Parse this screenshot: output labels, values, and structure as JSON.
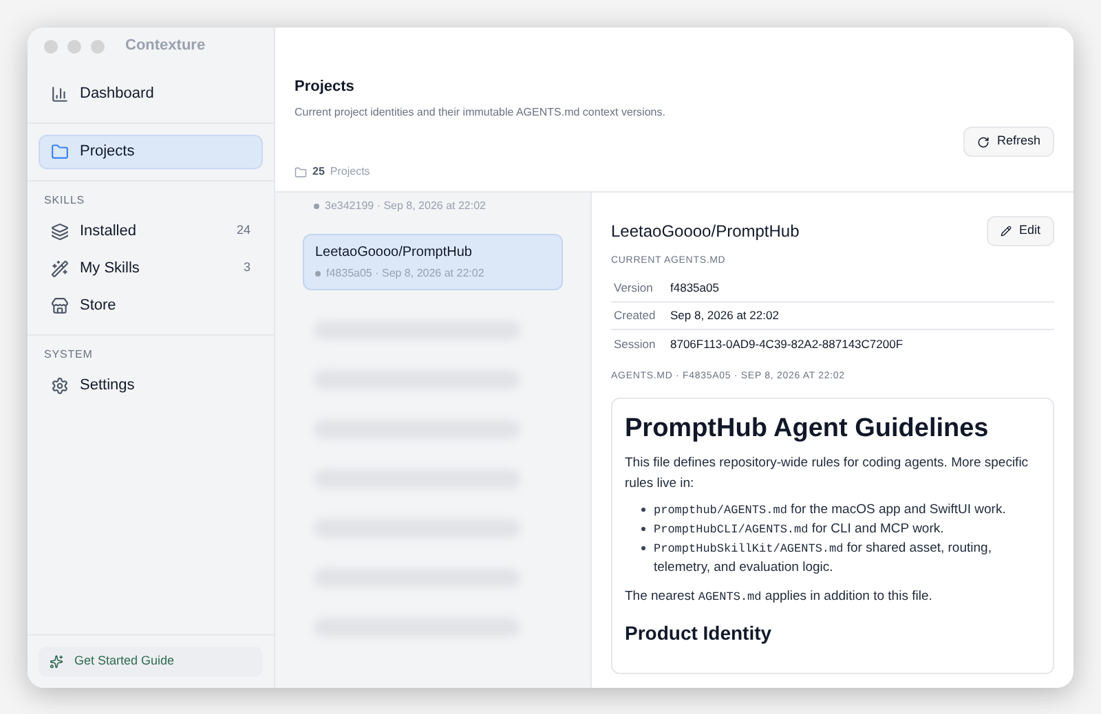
{
  "window": {
    "title": "Contexture"
  },
  "sidebar": {
    "items": [
      {
        "kind": "dashboard",
        "label": "Dashboard",
        "selected": false
      }
    ],
    "sections": [
      {
        "items": [
          {
            "kind": "projects",
            "label": "Projects",
            "selected": true
          }
        ]
      },
      {
        "title": "SKILLS",
        "items": [
          {
            "kind": "installed",
            "label": "Installed",
            "count": "24",
            "selected": false
          },
          {
            "kind": "skills",
            "label": "My Skills",
            "count": "3",
            "selected": false
          },
          {
            "kind": "store",
            "label": "Store",
            "selected": false
          }
        ]
      },
      {
        "title": "SYSTEM",
        "items": [
          {
            "kind": "settings",
            "label": "Settings",
            "selected": false
          }
        ]
      }
    ],
    "footer": {
      "label": "Get Started Guide"
    }
  },
  "header": {
    "title": "Projects",
    "subtitle": "Current project identities and their immutable AGENTS.md context versions.",
    "refresh": "Refresh",
    "count": "25",
    "count_label": "Projects"
  },
  "projects": [
    {
      "kind": "partial",
      "meta": "3e342199 · Sep 8, 2026 at 22:02",
      "selected": false
    },
    {
      "kind": "row",
      "name": "LeetaoGoooo/PromptHub",
      "meta": "f4835a05 · Sep 8, 2026 at 22:02",
      "selected": true
    },
    {
      "kind": "blurred"
    },
    {
      "kind": "blurred"
    },
    {
      "kind": "blurred"
    },
    {
      "kind": "blurred"
    },
    {
      "kind": "blurred"
    },
    {
      "kind": "blurred"
    },
    {
      "kind": "blurred"
    }
  ],
  "detail": {
    "title": "LeetaoGoooo/PromptHub",
    "edit": "Edit",
    "section": "CURRENT AGENTS.MD",
    "fields": [
      {
        "label": "Version",
        "value": "f4835a05"
      },
      {
        "label": "Created",
        "value": "Sep 8, 2026 at 22:02"
      },
      {
        "label": "Session",
        "value": "8706F113-0AD9-4C39-82A2-887143C7200F"
      }
    ],
    "file_label": "AGENTS.MD · F4835A05 · SEP 8, 2026 AT 22:02",
    "markdown": {
      "title": "PromptHub Agent Guidelines",
      "intro": "This file defines repository-wide rules for coding agents. More specific rules live in:",
      "items": [
        {
          "code": "prompthub/AGENTS.md",
          "text": " for the macOS app and SwiftUI work."
        },
        {
          "code": "PromptHubCLI/AGENTS.md",
          "text": " for CLI and MCP work."
        },
        {
          "code": "PromptHubSkillKit/AGENTS.md",
          "text": " for shared asset, routing, telemetry, and evaluation logic."
        }
      ],
      "note": {
        "before": "The nearest ",
        "code": "AGENTS.md",
        "after": " applies in addition to this file."
      },
      "heading": "Product Identity"
    }
  }
}
